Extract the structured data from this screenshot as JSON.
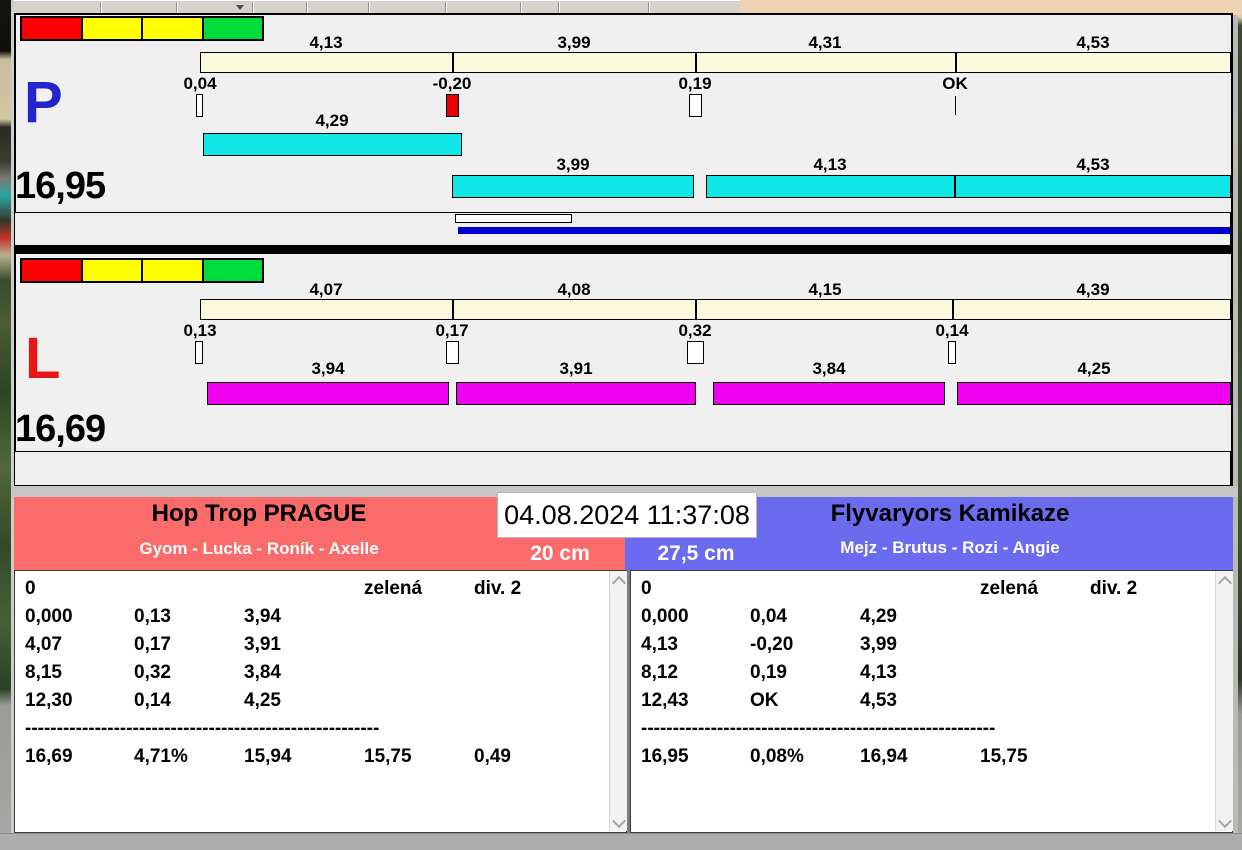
{
  "window": {
    "datetime": "04.08.2024 11:37:08"
  },
  "panel_p": {
    "letter": "P",
    "total": "16,95",
    "splits": [
      "4,13",
      "3,99",
      "4,31",
      "4,53"
    ],
    "marks": [
      "0,04",
      "-0,20",
      "0,19",
      "OK"
    ],
    "bars": [
      "4,29",
      "3,99",
      "4,13",
      "4,53"
    ]
  },
  "panel_l": {
    "letter": "L",
    "total": "16,69",
    "splits": [
      "4,07",
      "4,08",
      "4,15",
      "4,39"
    ],
    "marks": [
      "0,13",
      "0,17",
      "0,32",
      "0,14"
    ],
    "bars": [
      "3,94",
      "3,91",
      "3,84",
      "4,25"
    ]
  },
  "team_left": {
    "name": "Hop Trop PRAGUE",
    "members": "Gyom - Lucka - Roník - Axelle",
    "distance": "20 cm",
    "table": {
      "row0": [
        "0",
        "zelená",
        "div. 2"
      ],
      "rows": [
        [
          "0,000",
          "0,13",
          "3,94"
        ],
        [
          "4,07",
          "0,17",
          "3,91"
        ],
        [
          "8,15",
          "0,32",
          "3,84"
        ],
        [
          "12,30",
          "0,14",
          "4,25"
        ]
      ],
      "separator": "--------------------------------------------------------",
      "totals": [
        "16,69",
        "4,71%",
        "15,94",
        "15,75",
        "0,49"
      ]
    }
  },
  "team_right": {
    "name": "Flyvaryors Kamikaze",
    "members": "Mejz - Brutus - Rozi - Angie",
    "distance": "27,5 cm",
    "table": {
      "row0": [
        "0",
        "zelená",
        "div. 2"
      ],
      "rows": [
        [
          "0,000",
          "0,04",
          "4,29"
        ],
        [
          "4,13",
          "-0,20",
          "3,99"
        ],
        [
          "8,12",
          "0,19",
          "4,13"
        ],
        [
          "12,43",
          "OK",
          "4,53"
        ]
      ],
      "separator": "--------------------------------------------------------",
      "totals": [
        "16,95",
        "0,08%",
        "16,94",
        "15,75"
      ]
    }
  },
  "colors": {
    "legend": [
      "#FF0000",
      "#FFFF00",
      "#FFFF00",
      "#00DC3C"
    ],
    "split_bar": "#FBF9DC",
    "p_bar": "#12E7E7",
    "l_bar": "#EE00EE",
    "p_letter": "#2424CC",
    "l_letter": "#E61717",
    "progress_bar": "#0000CC",
    "marker_alert": "#E60000",
    "team_left": "#FA6B6B",
    "team_right": "#6B6BEF"
  }
}
